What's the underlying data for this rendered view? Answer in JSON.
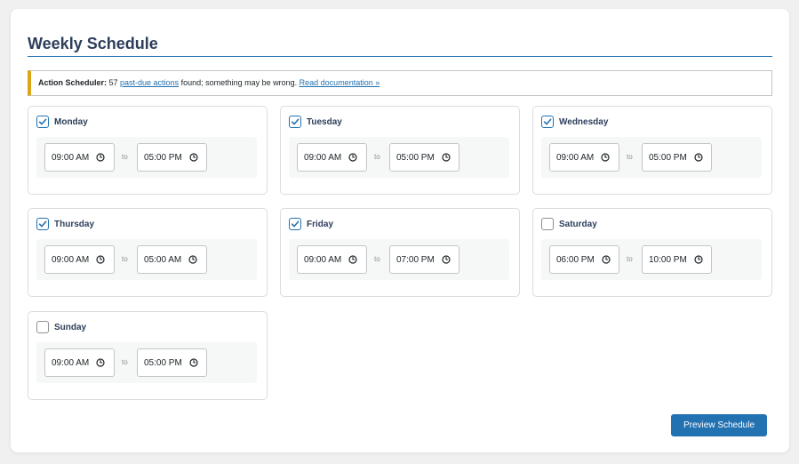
{
  "page": {
    "title": "Weekly Schedule"
  },
  "notice": {
    "label": "Action Scheduler:",
    "count_text": " 57 ",
    "link1": "past-due actions",
    "middle": " found; something may be wrong. ",
    "link2": "Read documentation »"
  },
  "days": [
    {
      "name": "Monday",
      "checked": true,
      "start": "09:00 AM",
      "sep": "to",
      "end": "05:00 PM"
    },
    {
      "name": "Tuesday",
      "checked": true,
      "start": "09:00 AM",
      "sep": "to",
      "end": "05:00 PM"
    },
    {
      "name": "Wednesday",
      "checked": true,
      "start": "09:00 AM",
      "sep": "to",
      "end": "05:00 PM"
    },
    {
      "name": "Thursday",
      "checked": true,
      "start": "09:00 AM",
      "sep": "to",
      "end": "05:00 AM"
    },
    {
      "name": "Friday",
      "checked": true,
      "start": "09:00 AM",
      "sep": "to",
      "end": "07:00 PM"
    },
    {
      "name": "Saturday",
      "checked": false,
      "start": "06:00 PM",
      "sep": "to",
      "end": "10:00 PM"
    },
    {
      "name": "Sunday",
      "checked": false,
      "start": "09:00 AM",
      "sep": "to",
      "end": "05:00 PM"
    }
  ],
  "actions": {
    "preview_label": "Preview Schedule"
  },
  "icons": {
    "checkbox": "checkmark-icon",
    "time": "clock-icon"
  },
  "colors": {
    "accent": "#2271b1",
    "title": "#2c3e5a",
    "notice_border": "#dba617"
  }
}
